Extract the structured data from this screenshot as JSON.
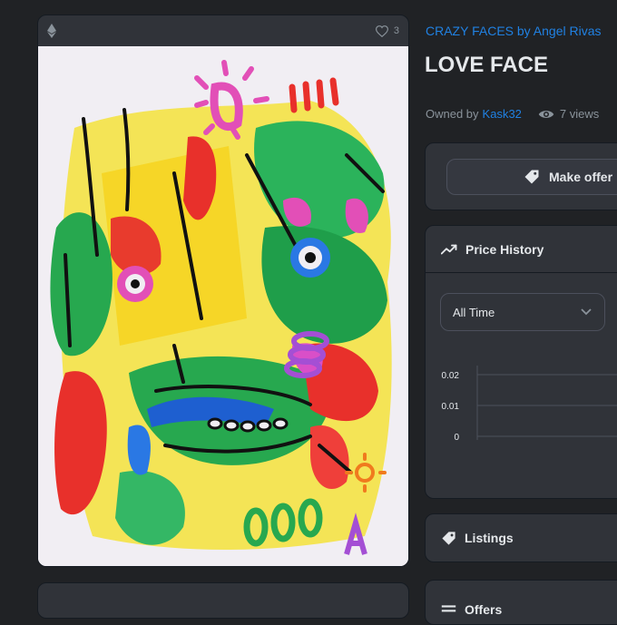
{
  "image_card": {
    "like_count": "3"
  },
  "item": {
    "collection": "CRAZY FACES by Angel Rivas",
    "title": "LOVE FACE",
    "owned_by_label": "Owned by",
    "owner": "Kask32",
    "views": "7 views"
  },
  "actions": {
    "make_offer": "Make offer"
  },
  "price_history": {
    "title": "Price History",
    "range_selected": "All Time"
  },
  "chart_data": {
    "type": "line",
    "y_ticks": [
      "0.02",
      "0.01",
      "0"
    ],
    "ylim": [
      0,
      0.02
    ],
    "series": []
  },
  "panels": {
    "listings": "Listings",
    "offers": "Offers"
  },
  "colors": {
    "background": "#202225",
    "card": "#303339",
    "link": "#2081e2",
    "text": "#e5e8eb",
    "muted": "#8a939b"
  }
}
